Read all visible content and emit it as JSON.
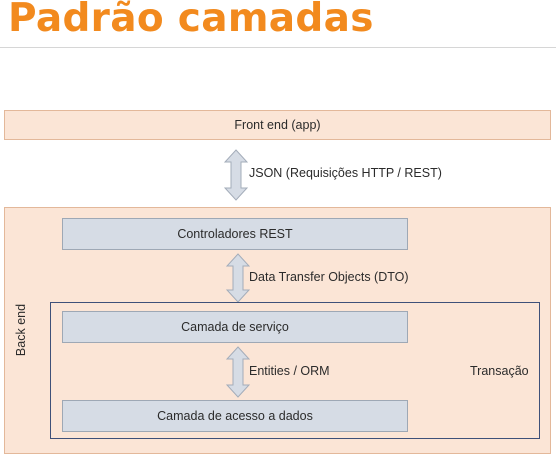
{
  "slide": {
    "title": "Padrão camadas"
  },
  "diagram": {
    "frontend_box": "Front end (app)",
    "backend_label": "Back end",
    "json_label": "JSON (Requisições HTTP / REST)",
    "controllers_box": "Controladores REST",
    "dto_label": "Data Transfer Objects (DTO)",
    "service_box": "Camada de serviço",
    "entities_label": "Entities / ORM",
    "data_access_box": "Camada de acesso a dados",
    "transaction_label": "Transação"
  },
  "colors": {
    "title": "#f28a1e",
    "peach_fill": "#fbe5d6",
    "layer_fill": "#d6dce5",
    "arrow_fill": "#d6dce5",
    "arrow_stroke": "#a3acb9",
    "frame_border": "#3e5079"
  }
}
